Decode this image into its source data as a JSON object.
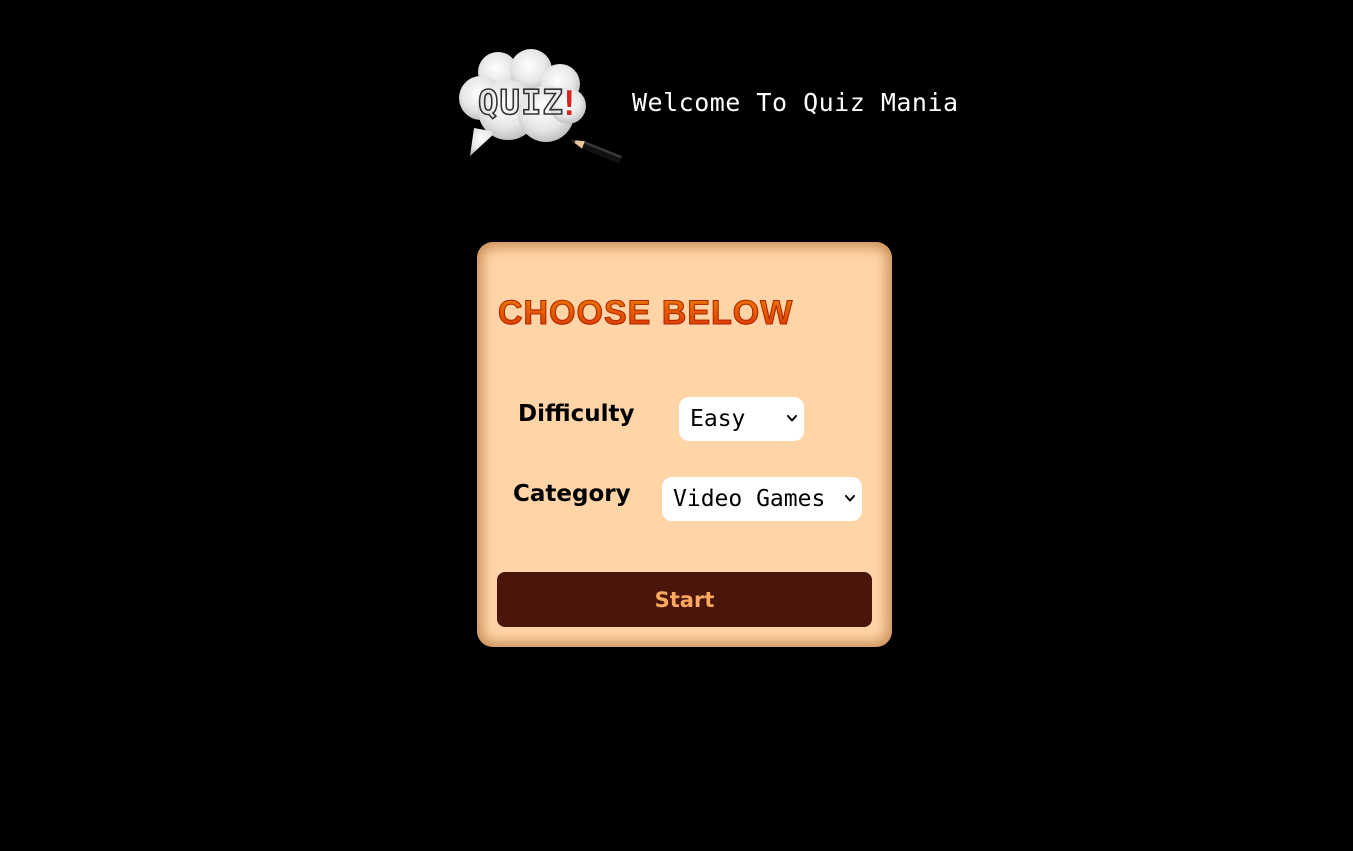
{
  "header": {
    "logo_text": "QUIZ!",
    "welcome_text": "Welcome To Quiz Mania"
  },
  "form": {
    "title": "CHOOSE BELOW",
    "difficulty": {
      "label": "Difficulty",
      "selected": "Easy"
    },
    "category": {
      "label": "Category",
      "selected": "Video Games"
    },
    "start_label": "Start"
  },
  "colors": {
    "background": "#000000",
    "card": "#ffd5a8",
    "title": "#e04a00",
    "button": "#4a160c",
    "button_text": "#ffa860"
  },
  "icons": {
    "logo": "quiz-speech-bubble-with-pencil",
    "select_arrow": "chevron-down-icon"
  }
}
